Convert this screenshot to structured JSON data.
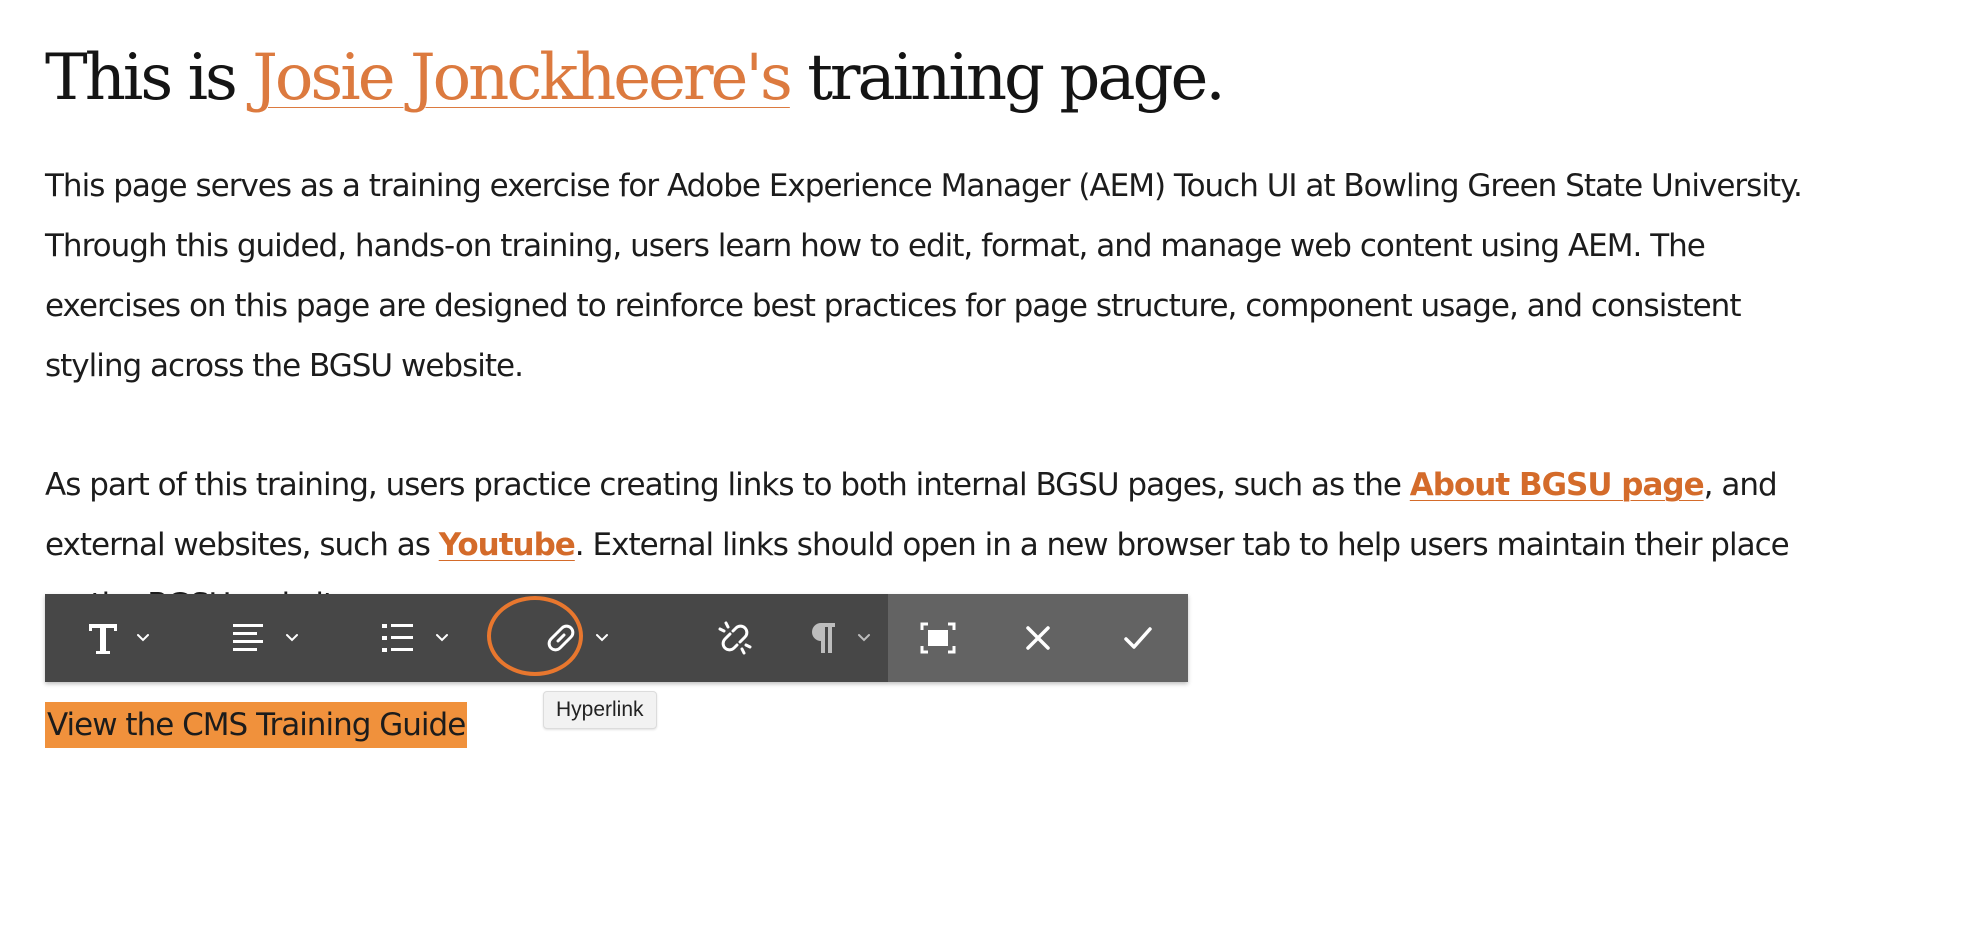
{
  "heading": {
    "prefix": "This is ",
    "link_text": "Josie Jonckheere's",
    "suffix": " training page."
  },
  "paragraph1": {
    "lines": [
      "This page serves as a training exercise for Adobe Experience Manager (AEM) Touch UI at Bowling Green State University.",
      "Through this guided, hands-on training, users learn how to edit, format, and manage web content using AEM. The",
      "exercises on this page are designed to reinforce best practices for page structure, component usage, and consistent",
      "styling across the BGSU website."
    ]
  },
  "paragraph2": {
    "line1_before": "As part of this training, users practice creating links to both internal BGSU pages, such as the ",
    "line1_link": "About BGSU page",
    "line1_after": ", and",
    "line2_before": "external websites, such as ",
    "line2_link": "Youtube",
    "line2_after": ". External links should open in a new browser tab to help users maintain their place",
    "line3": "on the BGSU website."
  },
  "cta": {
    "text": "View the CMS Training Guide"
  },
  "toolbar": {
    "tooltip": "Hyperlink",
    "buttons": [
      {
        "name": "text-format",
        "icon": "text-format-icon",
        "has_dropdown": true
      },
      {
        "name": "justify",
        "icon": "align-left-icon",
        "has_dropdown": true
      },
      {
        "name": "lists",
        "icon": "list-icon",
        "has_dropdown": true
      },
      {
        "name": "hyperlink",
        "icon": "link-icon",
        "has_dropdown": true,
        "active": true
      },
      {
        "name": "unlink",
        "icon": "unlink-icon",
        "has_dropdown": false
      },
      {
        "name": "paragraph-format",
        "icon": "pilcrow-icon",
        "has_dropdown": true
      },
      {
        "name": "fullscreen",
        "icon": "fullscreen-icon",
        "has_dropdown": false
      },
      {
        "name": "cancel",
        "icon": "close-icon",
        "has_dropdown": false
      },
      {
        "name": "save",
        "icon": "checkmark-icon",
        "has_dropdown": false
      }
    ]
  },
  "colors": {
    "accent": "#dc7a3f",
    "highlight": "#f0913c",
    "toolbar_dark": "#474747",
    "toolbar_light": "#636363",
    "focus_ring": "#e8772e"
  }
}
